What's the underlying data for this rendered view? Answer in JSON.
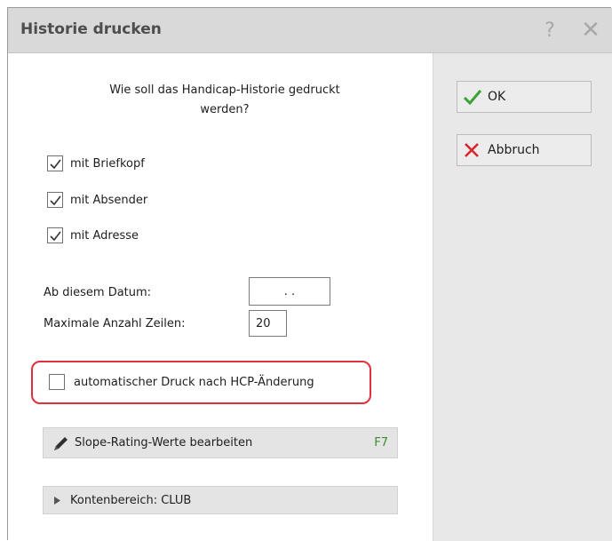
{
  "window": {
    "title": "Historie drucken",
    "help_glyph": "?",
    "close_glyph": "✕"
  },
  "question": "Wie soll das Handicap-Historie gedruckt werden?",
  "options": [
    {
      "label": "mit Briefkopf",
      "checked": true
    },
    {
      "label": "mit Absender",
      "checked": true
    },
    {
      "label": "mit Adresse",
      "checked": true
    }
  ],
  "fields": {
    "date_label": "Ab diesem Datum:",
    "date_value": ". .",
    "max_rows_label": "Maximale Anzahl Zeilen:",
    "max_rows_value": "20"
  },
  "auto_print": {
    "label": "automatischer Druck nach HCP-Änderung",
    "checked": false
  },
  "slope_button": {
    "label": "Slope-Rating-Werte bearbeiten",
    "shortcut": "F7",
    "icon": "pencil-icon"
  },
  "account_area": {
    "label": "Kontenbereich: CLUB",
    "icon": "triangle-right-icon"
  },
  "buttons": {
    "ok_label": "OK",
    "cancel_label": "Abbruch"
  },
  "colors": {
    "ok_check": "#3aa335",
    "cancel_x": "#d9262c",
    "highlight": "#e0303b",
    "shortcut": "#3c8a2e",
    "titlebar": "#d9d9d9",
    "side_panel": "#e8e8e8"
  }
}
